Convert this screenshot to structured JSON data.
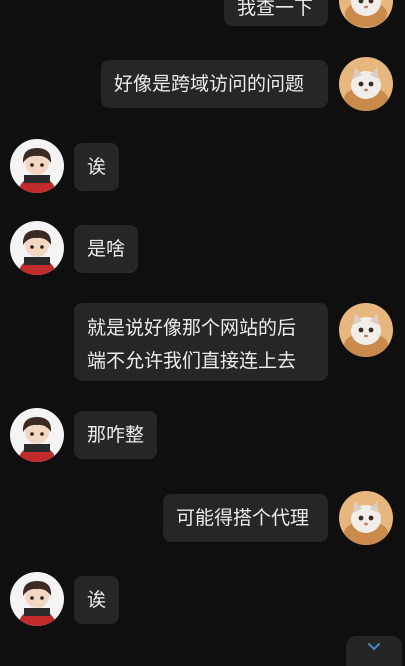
{
  "messages": [
    {
      "sender": "self",
      "text": "我查一下"
    },
    {
      "sender": "self",
      "text": "好像是跨域访问的问题"
    },
    {
      "sender": "other",
      "text": "诶"
    },
    {
      "sender": "other",
      "text": "是啥"
    },
    {
      "sender": "self",
      "text_lines": [
        "就是说好像那个网站的后",
        "端不允许我们直接连上去"
      ]
    },
    {
      "sender": "other",
      "text": "那咋整"
    },
    {
      "sender": "self",
      "text": "可能得搭个代理"
    },
    {
      "sender": "other",
      "text": "诶"
    }
  ],
  "avatars": {
    "self": {
      "icon": "cat-avatar-icon",
      "colors": {
        "bg": "#e7b77e",
        "fur": "#f1ede8"
      }
    },
    "other": {
      "icon": "cartoon-boy-avatar-icon",
      "colors": {
        "bg": "#f4f4f4",
        "hair": "#3a2a22",
        "shirt": "#c22b2b"
      }
    }
  },
  "scroll_button": {
    "icon": "chevron-down-icon",
    "color": "#4a88c7"
  }
}
